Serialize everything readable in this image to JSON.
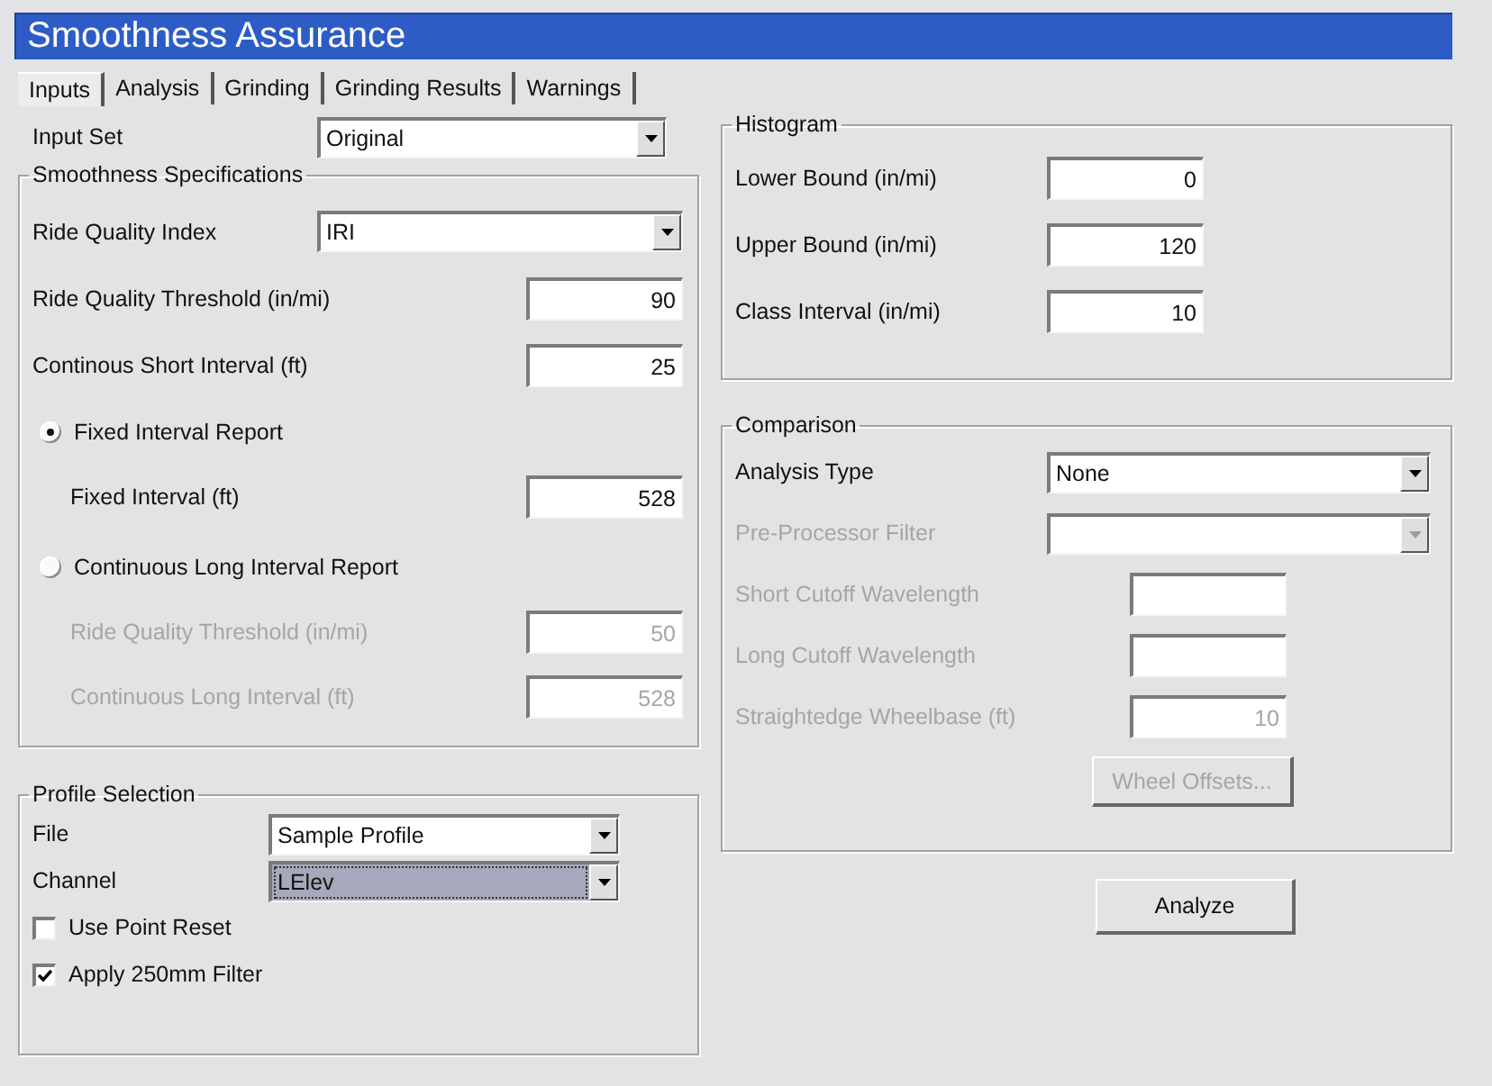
{
  "window": {
    "title": "Smoothness Assurance"
  },
  "tabs": [
    {
      "label": "Inputs",
      "selected": true
    },
    {
      "label": "Analysis",
      "selected": false
    },
    {
      "label": "Grinding",
      "selected": false
    },
    {
      "label": "Grinding Results",
      "selected": false
    },
    {
      "label": "Warnings",
      "selected": false
    }
  ],
  "input_set": {
    "kind": "combo",
    "label": "Input Set",
    "value": "Original",
    "disabled": false,
    "focused": false
  },
  "smoothness_specifications": {
    "title": "Smoothness Specifications",
    "rows": [
      {
        "kind": "combo",
        "label": "Ride Quality Index",
        "value": "IRI",
        "disabled": false,
        "focused": false
      },
      {
        "kind": "edit",
        "label": "Ride Quality Threshold (in/mi)",
        "value": "90",
        "disabled": false
      },
      {
        "kind": "edit",
        "label": "Continous Short Interval (ft)",
        "value": "25",
        "disabled": false
      },
      {
        "kind": "radio",
        "label": "Fixed Interval Report",
        "selected": true,
        "children": [
          {
            "kind": "edit",
            "label": "Fixed Interval (ft)",
            "value": "528",
            "disabled": false
          }
        ]
      },
      {
        "kind": "radio",
        "label": "Continuous Long Interval Report",
        "selected": false,
        "children": [
          {
            "kind": "edit",
            "label": "Ride Quality Threshold (in/mi)",
            "value": "50",
            "disabled": true
          },
          {
            "kind": "edit",
            "label": "Continuous Long Interval (ft)",
            "value": "528",
            "disabled": true
          }
        ]
      }
    ]
  },
  "profile_selection": {
    "title": "Profile Selection",
    "rows": [
      {
        "kind": "combo",
        "label": "File",
        "value": "Sample Profile",
        "disabled": false,
        "focused": false
      },
      {
        "kind": "combo",
        "label": "Channel",
        "value": "LElev",
        "disabled": false,
        "focused": true
      },
      {
        "kind": "check",
        "label": "Use Point Reset",
        "checked": false
      },
      {
        "kind": "check",
        "label": "Apply 250mm Filter",
        "checked": true
      }
    ]
  },
  "histogram": {
    "title": "Histogram",
    "rows": [
      {
        "kind": "edit",
        "label": "Lower Bound (in/mi)",
        "value": "0",
        "disabled": false
      },
      {
        "kind": "edit",
        "label": "Upper Bound (in/mi)",
        "value": "120",
        "disabled": false
      },
      {
        "kind": "edit",
        "label": "Class Interval (in/mi)",
        "value": "10",
        "disabled": false
      }
    ]
  },
  "comparison": {
    "title": "Comparison",
    "rows": [
      {
        "kind": "combo",
        "label": "Analysis Type",
        "value": "None",
        "disabled": false,
        "focused": false
      },
      {
        "kind": "combo",
        "label": "Pre-Processor Filter",
        "disabled": true,
        "focused": false
      },
      {
        "kind": "edit",
        "label": "Short Cutoff Wavelength",
        "disabled": true
      },
      {
        "kind": "edit",
        "label": "Long Cutoff Wavelength",
        "disabled": true
      },
      {
        "kind": "edit",
        "label": "Straightedge Wheelbase (ft)",
        "value": "10",
        "disabled": true
      },
      {
        "kind": "button",
        "label": "Wheel Offsets...",
        "disabled": true
      }
    ]
  },
  "analyze_button": {
    "label": "Analyze",
    "disabled": false
  }
}
